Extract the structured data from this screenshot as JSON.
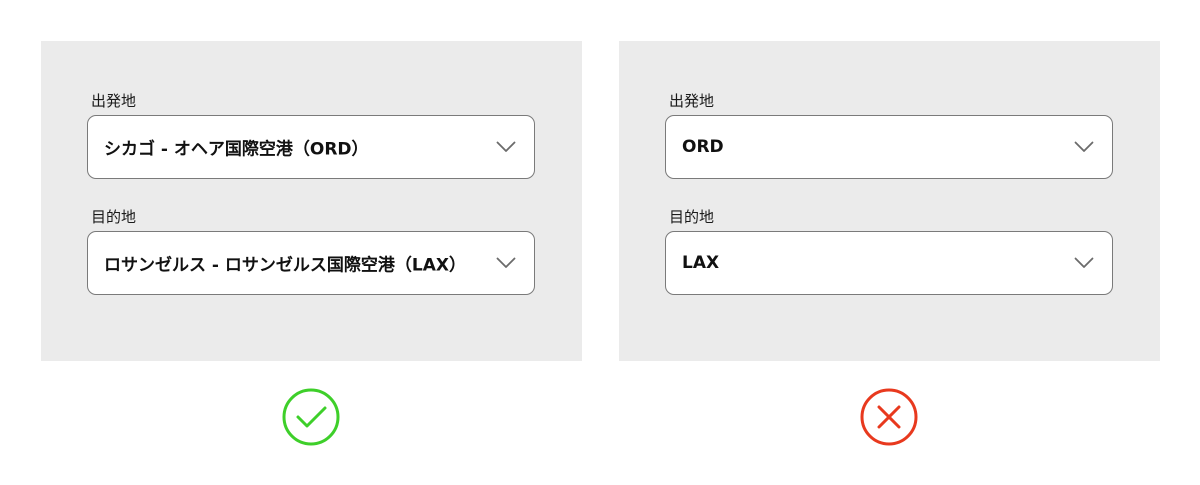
{
  "good_example": {
    "origin_label": "出発地",
    "origin_value": "シカゴ - オヘア国際空港（ORD）",
    "destination_label": "目的地",
    "destination_value": "ロサンゼルス - ロサンゼルス国際空港（LAX）",
    "status_icon": "check-circle-icon",
    "status_color": "#3ecf2a"
  },
  "bad_example": {
    "origin_label": "出発地",
    "origin_value": "ORD",
    "destination_label": "目的地",
    "destination_value": "LAX",
    "status_icon": "x-circle-icon",
    "status_color": "#e8391e"
  },
  "colors": {
    "panel_background": "#ebebeb",
    "field_border": "#7a7a7a",
    "chevron": "#6b6b6b"
  },
  "icons": {
    "dropdown": "chevron-down-icon"
  }
}
